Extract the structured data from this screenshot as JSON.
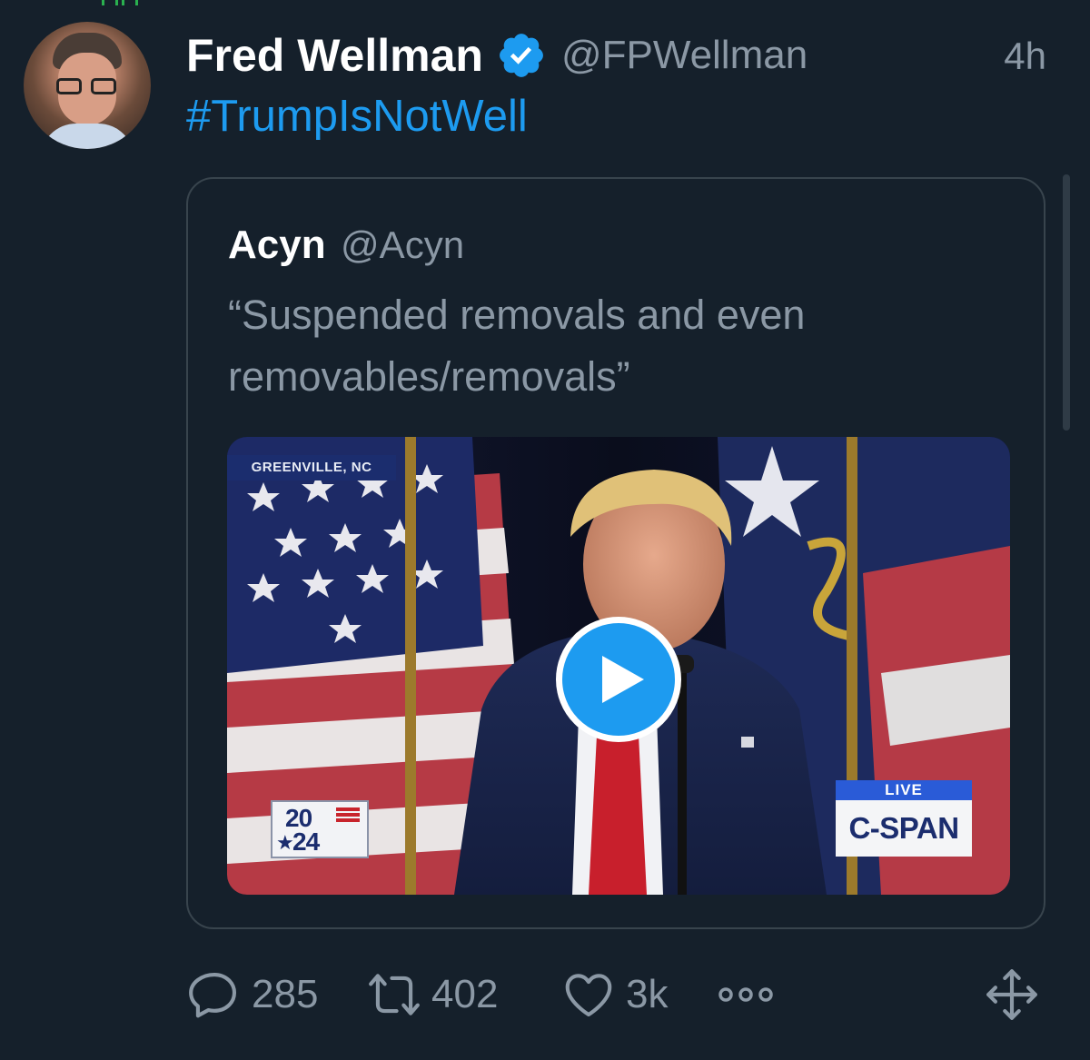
{
  "colors": {
    "background": "#15202b",
    "accent": "#1d9bf0",
    "secondary_text": "#8b98a5",
    "border": "#38444d"
  },
  "tweet": {
    "author_name": "Fred Wellman",
    "author_handle": "@FPWellman",
    "timestamp": "4h",
    "text": "#TrumpIsNotWell",
    "verified": true
  },
  "quoted_tweet": {
    "author_name": "Acyn",
    "author_handle": "@Acyn",
    "text": "“Suspended removals and even removables/removals”",
    "video": {
      "location_tag": "GREENVILLE, NC",
      "year_badge_top": "20",
      "year_badge_bottom": "24",
      "live_label": "LIVE",
      "network_label": "C-SPAN"
    }
  },
  "actions": {
    "replies": "285",
    "retweets": "402",
    "likes": "3k"
  },
  "icons": {
    "verified": "verified-badge-icon",
    "reply": "reply-icon",
    "retweet": "retweet-icon",
    "like": "heart-icon",
    "more": "more-icon",
    "move": "move-icon",
    "play": "play-icon"
  }
}
